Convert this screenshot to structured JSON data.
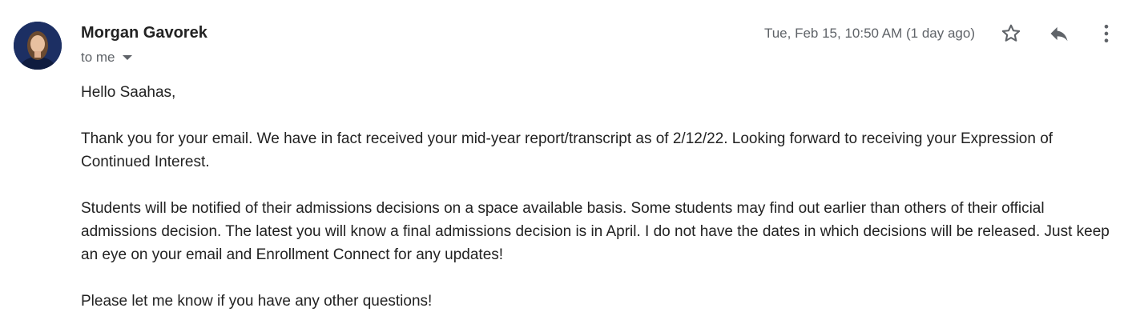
{
  "sender": {
    "name": "Morgan Gavorek",
    "avatar_icon": "profile-photo"
  },
  "recipient": {
    "label": "to me",
    "dropdown_icon": "caret-down-icon"
  },
  "header": {
    "timestamp": "Tue, Feb 15, 10:50 AM (1 day ago)",
    "actions": {
      "star_icon": "star-outline-icon",
      "reply_icon": "reply-icon",
      "more_icon": "more-vertical-icon"
    }
  },
  "message": {
    "greeting": "Hello Saahas,",
    "paragraphs": [
      "Thank you for your email. We have in fact received your mid-year report/transcript as of 2/12/22. Looking forward to receiving your Expression of Continued Interest.",
      "Students will be notified of their admissions decisions on a space available basis. Some students may find out earlier than others of their official admissions decision. The latest you will know a final admissions decision is in April. I do not have the dates in which decisions will be released. Just keep an eye on your email and Enrollment Connect for any updates!",
      "Please let me know if you have any other questions!"
    ]
  },
  "colors": {
    "text_primary": "#222222",
    "text_secondary": "#5f6368",
    "icon": "#5f6368",
    "avatar_bg": "#1c2f63"
  }
}
